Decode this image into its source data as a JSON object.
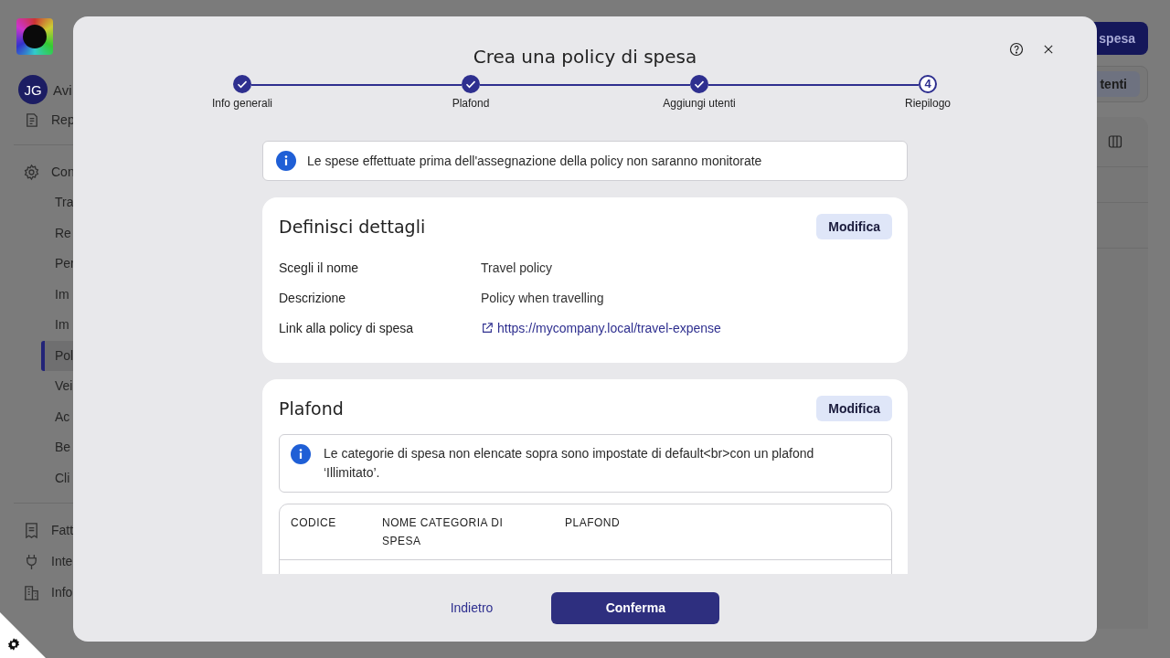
{
  "background": {
    "sidebar": {
      "user_initials": "JG",
      "user_name": "Avi",
      "items": [
        {
          "label": "Rep",
          "kind": "report"
        },
        {
          "label": "Con",
          "kind": "settings"
        },
        {
          "label": "Tra",
          "kind": "sub",
          "selected": false
        },
        {
          "label": "Re",
          "kind": "sub",
          "selected": false
        },
        {
          "label": "Per",
          "kind": "sub",
          "selected": false
        },
        {
          "label": "Im",
          "kind": "sub",
          "selected": false
        },
        {
          "label": "Im",
          "kind": "sub",
          "selected": false
        },
        {
          "label": "Pol",
          "kind": "sub",
          "selected": true
        },
        {
          "label": "Vei",
          "kind": "sub",
          "selected": false
        },
        {
          "label": "Ac",
          "kind": "sub",
          "selected": false
        },
        {
          "label": "Be",
          "kind": "sub",
          "selected": false
        },
        {
          "label": "Cli",
          "kind": "sub",
          "selected": false
        },
        {
          "label": "Fatt",
          "kind": "invoice"
        },
        {
          "label": "Inte",
          "kind": "plug"
        },
        {
          "label": "Info",
          "kind": "building"
        }
      ]
    },
    "header_button": "spesa",
    "filter_button": "tenti"
  },
  "modal": {
    "title": "Crea una policy di spesa",
    "steps": [
      {
        "label": "Info generali",
        "done": true
      },
      {
        "label": "Plafond",
        "done": true
      },
      {
        "label": "Aggiungi utenti",
        "done": true
      },
      {
        "label": "Riepilogo",
        "done": false,
        "number": "4"
      }
    ],
    "notice": "Le spese effettuate prima dell'assegnazione della policy non saranno monitorate",
    "details_card": {
      "title": "Definisci dettagli",
      "edit_button": "Modifica",
      "fields": [
        {
          "label": "Scegli il nome",
          "value": "Travel policy",
          "kind": "text"
        },
        {
          "label": "Descrizione",
          "value": "Policy when travelling",
          "kind": "text"
        },
        {
          "label": "Link alla policy di spesa",
          "value": "https://mycompany.local/travel-expense",
          "kind": "link"
        }
      ]
    },
    "plafond_card": {
      "title": "Plafond",
      "edit_button": "Modifica",
      "note": "Le categorie di spesa non elencate sopra sono impostate di default<br>con un plafond ‘Illimitato’.",
      "columns": [
        "CODICE",
        "NOME CATEGORIA DI SPESA",
        "PLAFOND"
      ]
    },
    "back_link": "Indietro",
    "confirm_button": "Conferma"
  }
}
